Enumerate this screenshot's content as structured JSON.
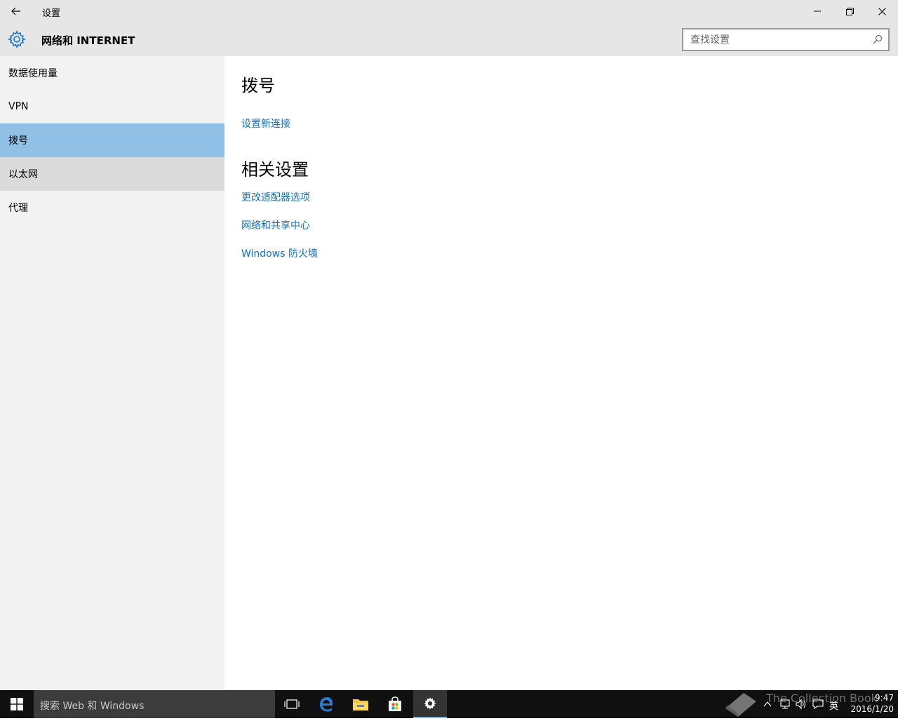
{
  "window": {
    "app_title": "设置",
    "page_title": "网络和 INTERNET"
  },
  "search": {
    "placeholder": "查找设置"
  },
  "sidebar": {
    "items": [
      {
        "label": "数据使用量"
      },
      {
        "label": "VPN"
      },
      {
        "label": "拨号"
      },
      {
        "label": "以太网"
      },
      {
        "label": "代理"
      }
    ]
  },
  "main": {
    "section_title": "拨号",
    "setup_link": "设置新连接",
    "related_title": "相关设置",
    "related_links": [
      {
        "label": "更改适配器选项"
      },
      {
        "label": "网络和共享中心"
      },
      {
        "label": "Windows 防火墙"
      }
    ]
  },
  "taskbar": {
    "search_text": "搜索 Web 和 Windows",
    "ime_label": "英",
    "time": "9:47",
    "date": "2016/1/20",
    "watermark": "The Collection Book"
  },
  "colors": {
    "accent": "#0f6fbe",
    "selected_item": "#91c0e7",
    "hover_item": "#dadada",
    "sidebar_bg": "#f2f2f2",
    "taskbar_bg": "#101010"
  }
}
